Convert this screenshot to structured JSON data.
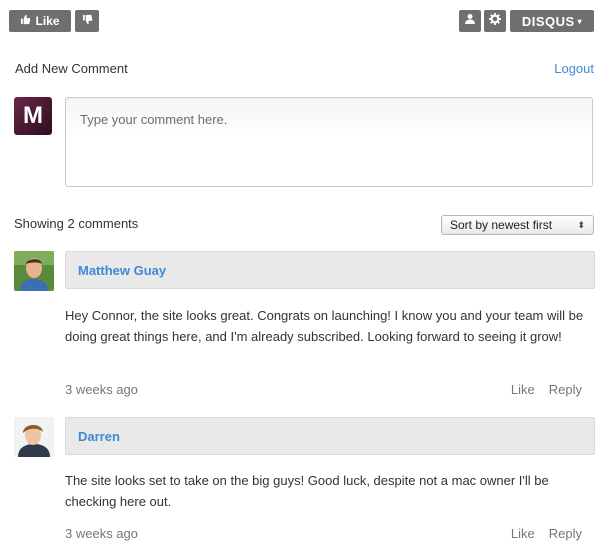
{
  "toolbar": {
    "like_label": "Like",
    "disqus_label": "DISQUS"
  },
  "compose": {
    "title": "Add New Comment",
    "logout": "Logout",
    "avatar_letter": "M",
    "placeholder": "Type your comment here."
  },
  "list": {
    "count_text": "Showing 2 comments",
    "sort_label": "Sort by newest first"
  },
  "comments": [
    {
      "author": "Matthew Guay",
      "body": "Hey Connor, the site looks great. Congrats on launching! I know you and your team will be doing great things here, and I'm already subscribed. Looking forward to seeing it grow!",
      "time": "3 weeks ago",
      "like": "Like",
      "reply": "Reply"
    },
    {
      "author": "Darren",
      "body": "The site looks set to take on the big guys! Good luck, despite not a mac owner I'll be checking here out.",
      "time": "3 weeks ago",
      "like": "Like",
      "reply": "Reply"
    }
  ],
  "colors": {
    "link": "#3d8ad8",
    "button_bg": "#6f6f6f"
  }
}
